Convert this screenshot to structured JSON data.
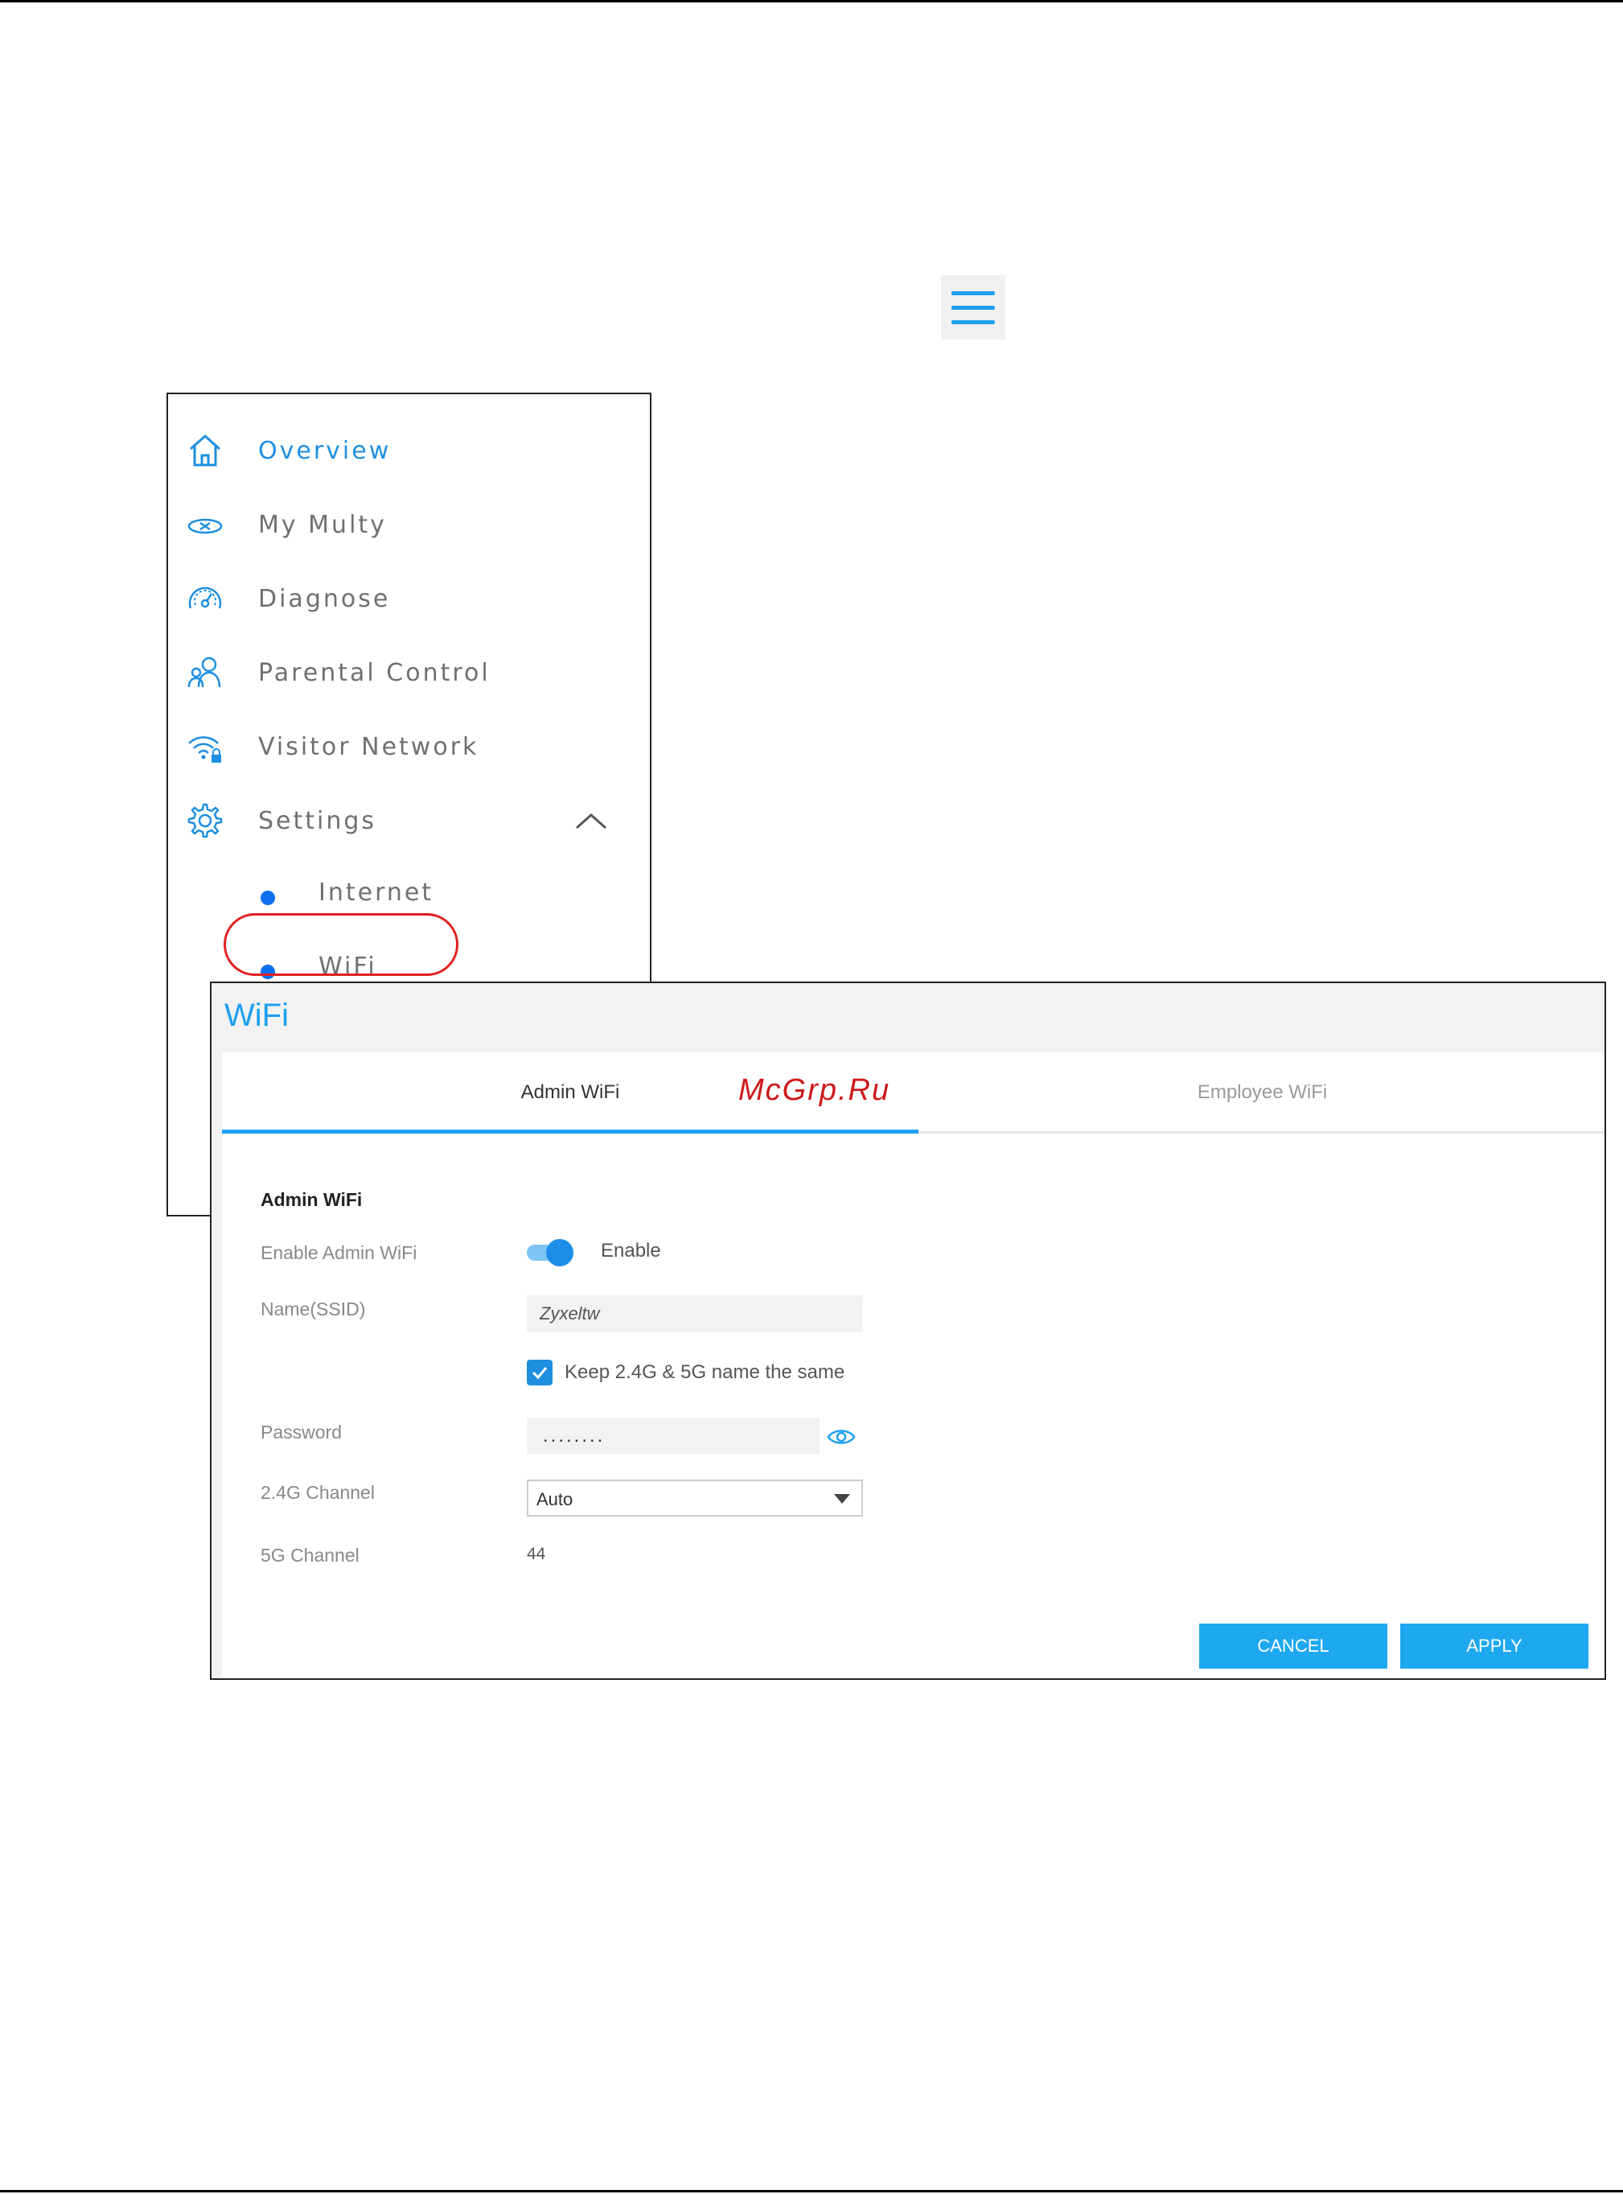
{
  "menu": {
    "items": [
      {
        "label": "Overview",
        "icon": "home-icon",
        "active": true
      },
      {
        "label": "My Multy",
        "icon": "router-icon"
      },
      {
        "label": "Diagnose",
        "icon": "speedometer-icon"
      },
      {
        "label": "Parental Control",
        "icon": "parental-control-icon"
      },
      {
        "label": "Visitor Network",
        "icon": "wifi-lock-icon"
      },
      {
        "label": "Settings",
        "icon": "gear-icon"
      }
    ],
    "subitems": [
      {
        "label": "Internet"
      },
      {
        "label": "WiFi"
      }
    ]
  },
  "panel": {
    "title": "WiFi",
    "tabs": [
      {
        "label": "Admin WiFi",
        "active": true
      },
      {
        "label": "Employee WiFi"
      }
    ],
    "watermark": "McGrp.Ru",
    "section_title": "Admin WiFi",
    "fields": {
      "enable_label": "Enable Admin WiFi",
      "enable_text": "Enable",
      "ssid_label": "Name(SSID)",
      "ssid_value": "Zyxeltw",
      "keep_same_label": "Keep 2.4G & 5G name the same",
      "password_label": "Password",
      "password_value": "........",
      "channel24_label": "2.4G Channel",
      "channel24_value": "Auto",
      "channel5_label": "5G Channel",
      "channel5_value": "44"
    },
    "buttons": {
      "cancel": "CANCEL",
      "apply": "APPLY"
    }
  },
  "colors": {
    "accent": "#1ea0f0",
    "highlight": "#e02020",
    "dot": "#0b6ff0"
  }
}
